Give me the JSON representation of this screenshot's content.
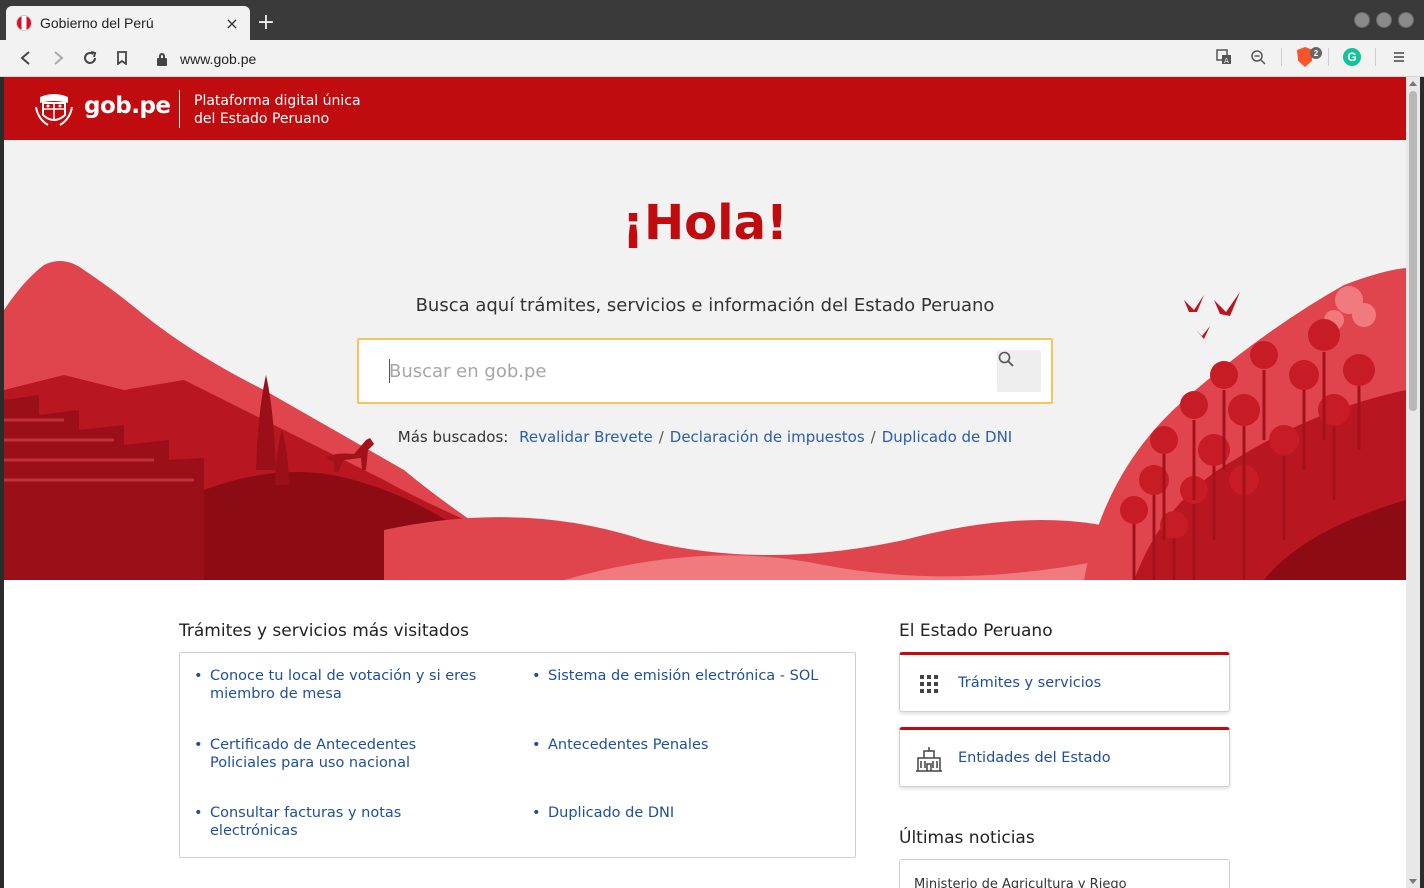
{
  "browser": {
    "tab_title": "Gobierno del Perú",
    "tab_close": "×",
    "new_tab": "+",
    "url": "www.gob.pe",
    "shields_count": "2"
  },
  "header": {
    "logo_text": "gob.pe",
    "subtitle_line1": "Plataforma digital única",
    "subtitle_line2": "del Estado Peruano"
  },
  "hero": {
    "greeting": "¡Hola!",
    "lead": "Busca aquí trámites, servicios e información del Estado Peruano",
    "search_placeholder": "Buscar en gob.pe",
    "popular_label": "Más buscados:",
    "popular_links": [
      "Revalidar Brevete",
      "Declaración de impuestos",
      "Duplicado de DNI"
    ],
    "separator": "/"
  },
  "services": {
    "title": "Trámites y servicios más visitados",
    "items": [
      "Conoce tu local de votación y si eres miembro de mesa",
      "Sistema de emisión electrónica - SOL",
      "Certificado de Antecedentes Policiales para uso nacional",
      "Antecedentes Penales",
      "Consultar facturas y notas electrónicas",
      "Duplicado de DNI"
    ]
  },
  "estado": {
    "title": "El Estado Peruano",
    "cards": [
      "Trámites y servicios",
      "Entidades del Estado"
    ],
    "icons": [
      "grid-icon",
      "building-icon"
    ]
  },
  "noticias": {
    "title": "Últimas noticias",
    "first_item": "Ministerio de Agricultura y Riego"
  },
  "colors": {
    "brand_red": "#c00c0f",
    "link_blue": "#1f4f9a",
    "search_border": "#f5c55a"
  }
}
